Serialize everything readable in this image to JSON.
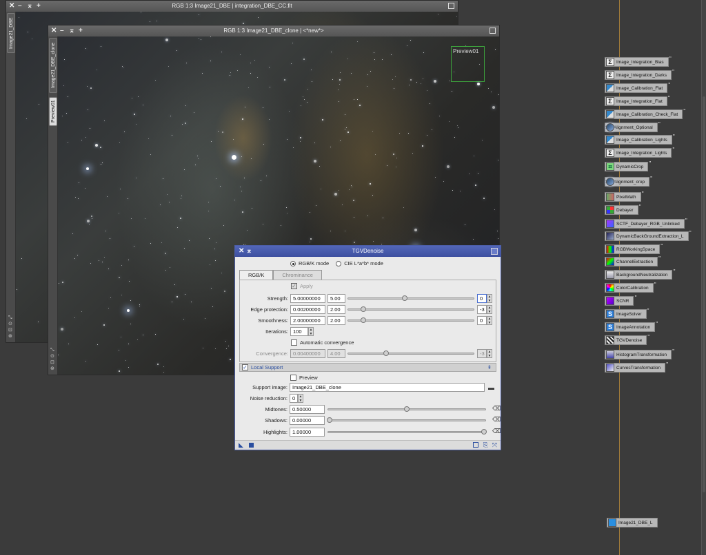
{
  "window_back": {
    "title": "RGB 1:3 Image21_DBE | integration_DBE_CC.fit",
    "side_tab": "Image21_DBE"
  },
  "window_front": {
    "title": "RGB 1:3 Image21_DBE_clone | <*new*>",
    "side_tab": "Image21_DBE_clone",
    "preview_tab": "Preview01",
    "preview_label": "Preview01"
  },
  "window_controls": {
    "close": "✕",
    "minimize": "–",
    "shade": "⌅",
    "maximize": "+"
  },
  "process_icons": [
    {
      "label": "Image_Integration_Bias",
      "icon": "sigma"
    },
    {
      "label": "Image_Integration_Darks",
      "icon": "sigma"
    },
    {
      "label": "Image_Calibration_Flat",
      "icon": "flat"
    },
    {
      "label": "Image_Integration_Flat",
      "icon": "sigma"
    },
    {
      "label": "Image_Calibration_Check_Flat",
      "icon": "flat"
    },
    {
      "label": "StarAlignment_Optional",
      "icon": "star"
    },
    {
      "label": "Image_Calibration_Lights",
      "icon": "flat"
    },
    {
      "label": "Image_Integration_Lights",
      "icon": "sigma"
    },
    {
      "label": "DynamicCrop",
      "icon": "crop"
    },
    {
      "label": "StarAlignment_crop",
      "icon": "star"
    },
    {
      "label": "PixelMath",
      "icon": "pm"
    },
    {
      "label": "Debayer",
      "icon": "deb"
    },
    {
      "label": "SCTF_Debayer_RGB_Unlinked",
      "icon": "scn"
    },
    {
      "label": "DynamicBackGroundExtraction_L",
      "icon": "dbe"
    },
    {
      "label": "RGBWorkingSpace",
      "icon": "rgbws"
    },
    {
      "label": "ChannelExtraction",
      "icon": "chan"
    },
    {
      "label": "BackgroundNeutralization",
      "icon": "bgn"
    },
    {
      "label": "ColorCalibration",
      "icon": "color"
    },
    {
      "label": "SCNR",
      "icon": "scnr"
    },
    {
      "label": "ImageSolver",
      "icon": "solver"
    },
    {
      "label": "ImageAnnotation",
      "icon": "solver"
    },
    {
      "label": "TGVDenoise",
      "icon": "tgv"
    },
    {
      "label": "HistogramTransformation",
      "icon": "hist"
    },
    {
      "label": "CurvesTransformation",
      "icon": "curves"
    }
  ],
  "image_icon": {
    "label": "Image21_DBE_L",
    "icon": "cube"
  },
  "dialog": {
    "title": "TGVDenoise",
    "mode_rgb": "RGB/K mode",
    "mode_lab": "CIE L*a*b* mode",
    "tab_rgb": "RGB/K",
    "tab_chroma": "Chrominance",
    "apply_label": "Apply",
    "strength": {
      "label": "Strength:",
      "value": "5.00000000",
      "short": "5.00",
      "exp": "0",
      "level": 0.45
    },
    "edge": {
      "label": "Edge protection:",
      "value": "0.00200000",
      "short": "2.00",
      "exp": "-3",
      "level": 0.12
    },
    "smooth": {
      "label": "Smoothness:",
      "value": "2.00000000",
      "short": "2.00",
      "exp": "0",
      "level": 0.12
    },
    "iterations": {
      "label": "Iterations:",
      "value": "100"
    },
    "auto_conv": "Automatic convergence",
    "convergence": {
      "label": "Convergence:",
      "value": "0.00400000",
      "short": "4.00",
      "exp": "-3",
      "level": 0.3
    },
    "local_support": "Local Support",
    "preview_label": "Preview",
    "support_image": {
      "label": "Support image:",
      "value": "Image21_DBE_clone"
    },
    "noise_reduction": {
      "label": "Noise reduction:",
      "value": "0"
    },
    "midtones": {
      "label": "Midtones:",
      "value": "0.50000",
      "level": 0.5
    },
    "shadows": {
      "label": "Shadows:",
      "value": "0.00000",
      "level": 0.0
    },
    "highlights": {
      "label": "Highlights:",
      "value": "1.00000",
      "level": 1.0
    }
  }
}
